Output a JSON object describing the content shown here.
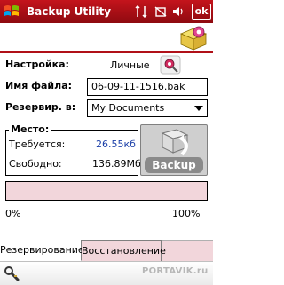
{
  "app": {
    "title": "Backup Utility",
    "ok_label": "ok"
  },
  "settings": {
    "label": "Настройка:",
    "value": "Личные"
  },
  "filename": {
    "label": "Имя файла:",
    "value": "06-09-11-1516.bak"
  },
  "backup_to": {
    "label": "Резервир. в:",
    "value": "My Documents"
  },
  "space": {
    "legend": "Место:",
    "required_label": "Требуется:",
    "required_value": "26.55кб",
    "free_label": "Свободно:",
    "free_value": "136.89Мб"
  },
  "backup_button": {
    "label": "Backup"
  },
  "progress": {
    "value": 0.0,
    "min_label": "0%",
    "max_label": "100%"
  },
  "tabs": [
    {
      "label": "Резервирование",
      "active": true
    },
    {
      "label": "Восстановление",
      "active": false
    }
  ],
  "watermark": "PORTAVIK.ru",
  "colors": {
    "titlebar": "#b3121a",
    "accent_blue": "#1b3fa8",
    "progress_bg": "#f2d6db"
  },
  "icons": [
    "windows-logo-icon",
    "signal-icon",
    "sync-icon",
    "volume-icon",
    "app-logo-icon",
    "gear-icon",
    "backup-arrow-icon",
    "tools-icon"
  ]
}
